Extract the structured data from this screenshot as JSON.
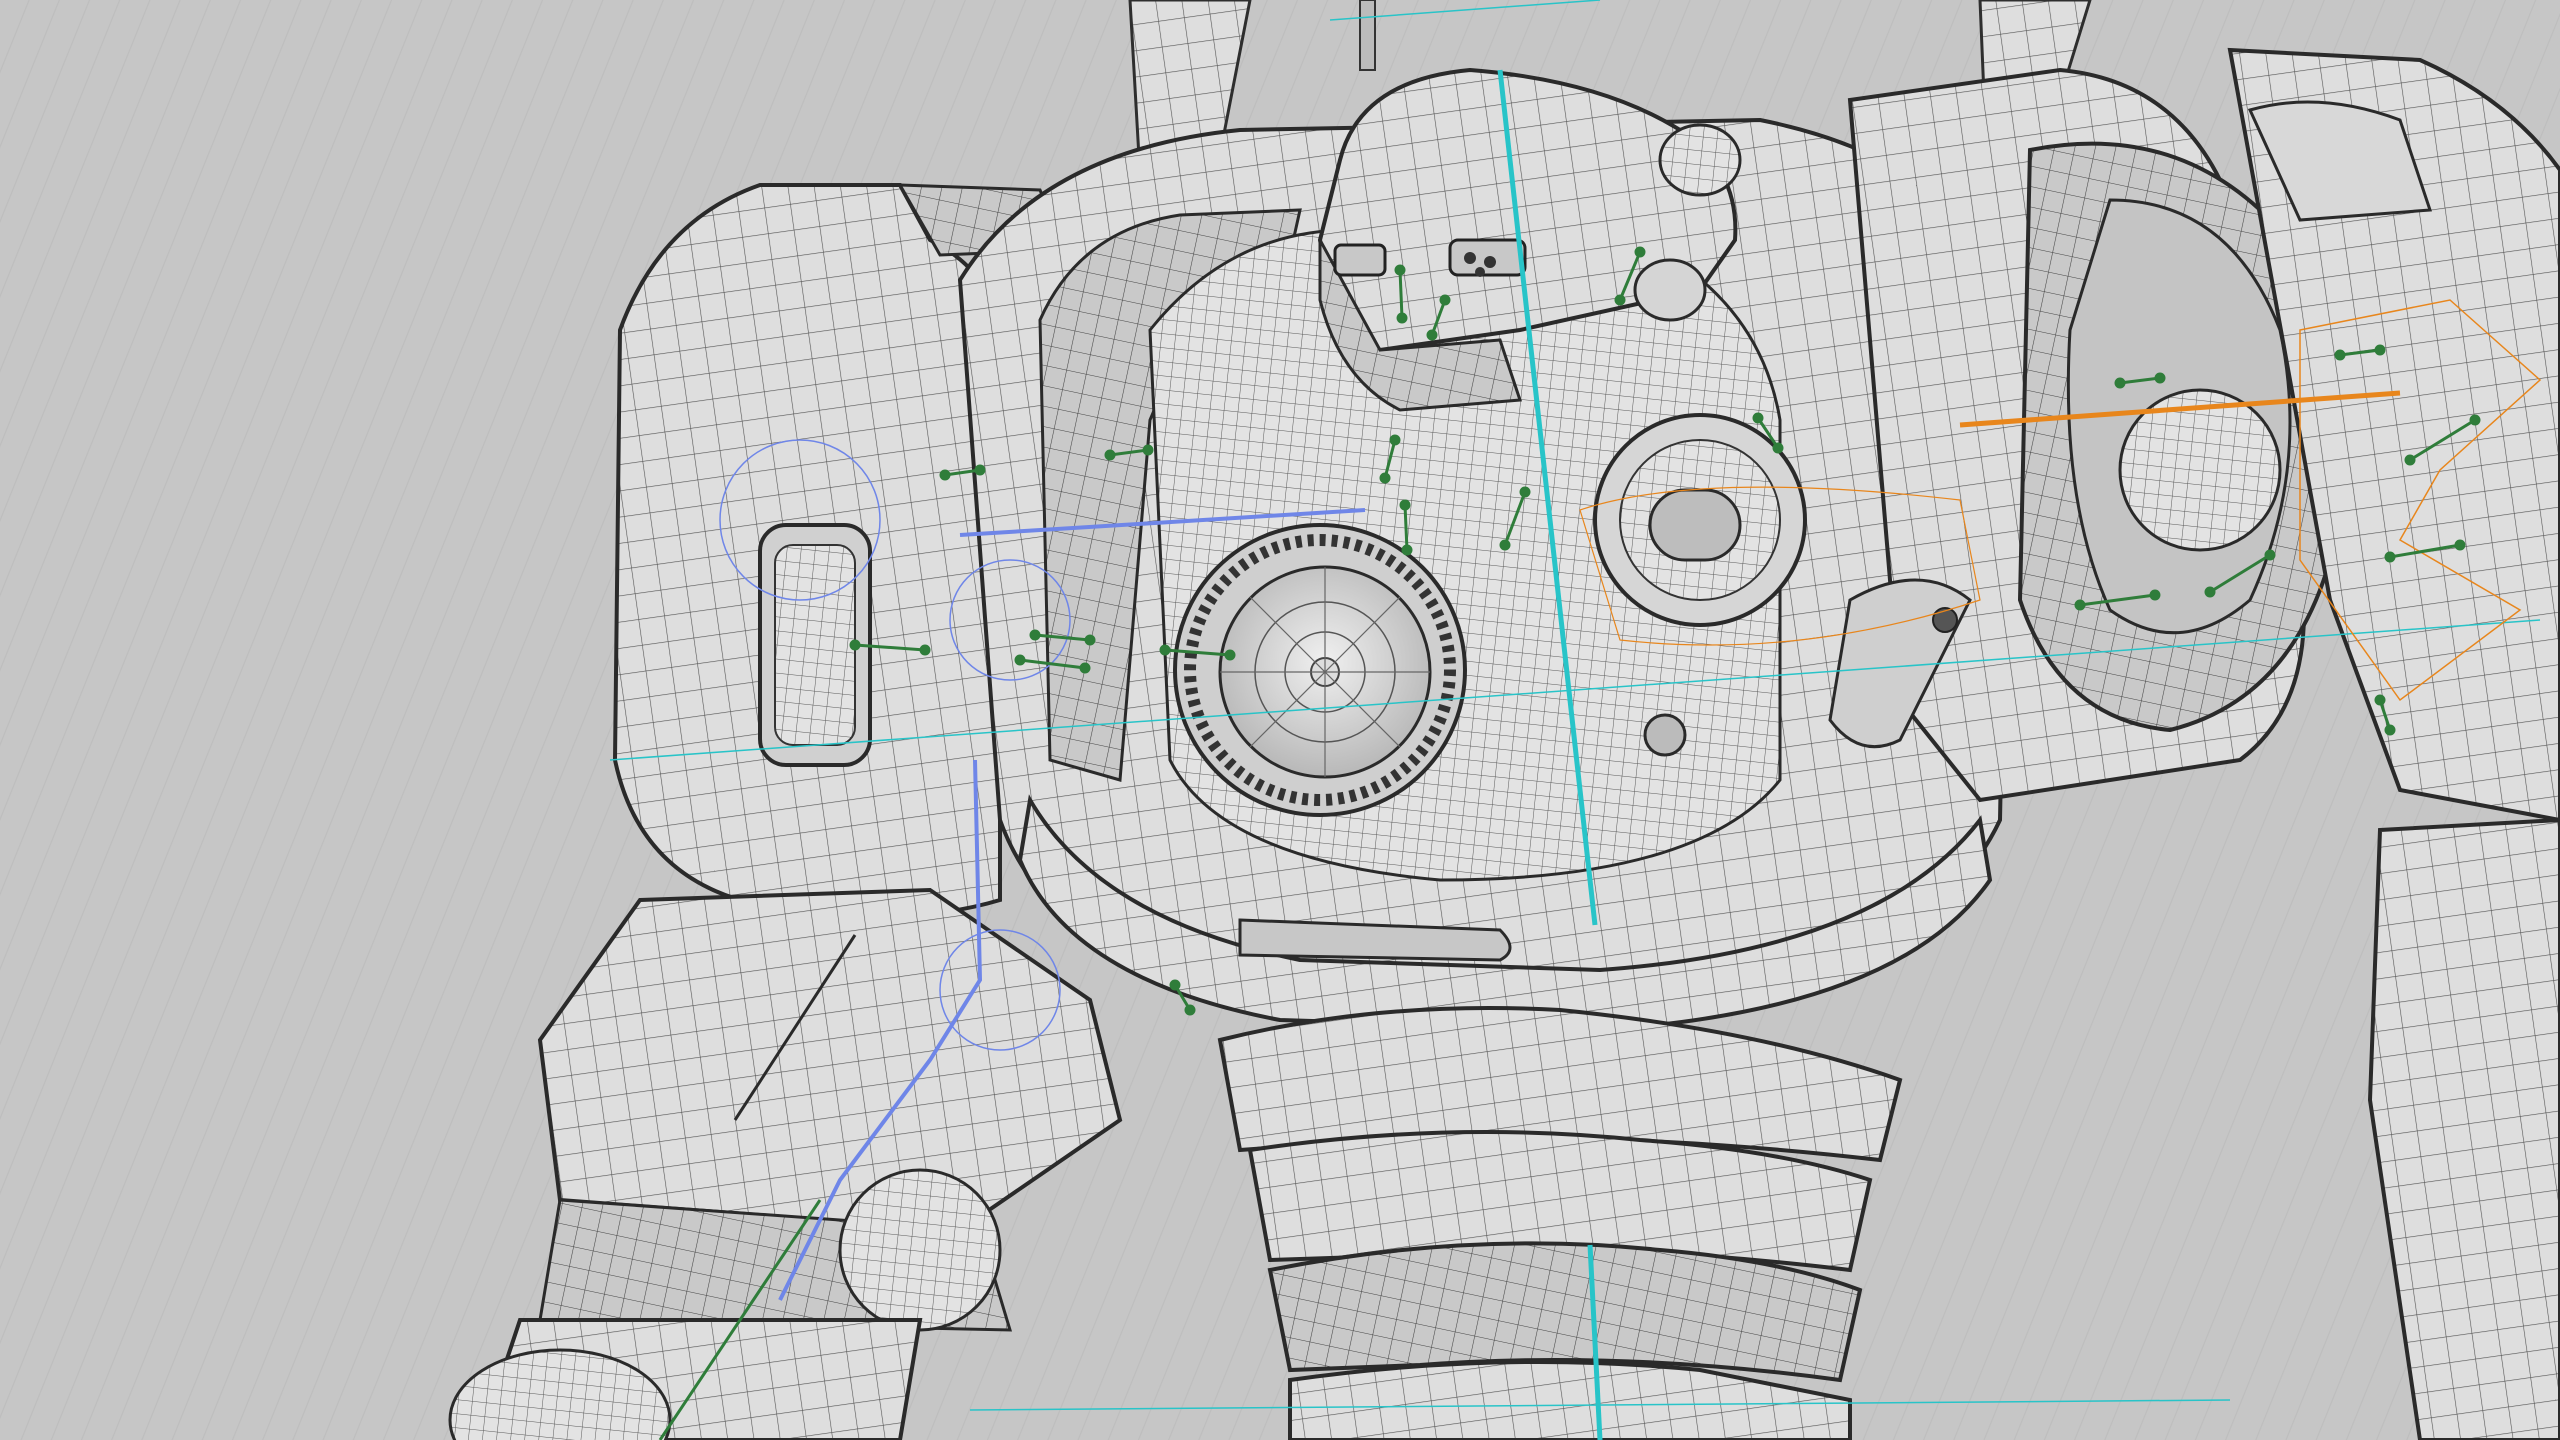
{
  "viewport": {
    "background": "#c4c4c4",
    "model": "mech-robot-wireframe"
  },
  "colors": {
    "mesh_line": "#2e2e2e",
    "panel_fill": "#dcdcdc",
    "cyan_guide": "#28c4c8",
    "orange_guide": "#e8861c",
    "blue_guide": "#6f86e8",
    "green_handle": "#2f7d3a"
  },
  "icons": [
    "wireframe-mesh",
    "rig-bone-handle",
    "axis-guide-line"
  ]
}
